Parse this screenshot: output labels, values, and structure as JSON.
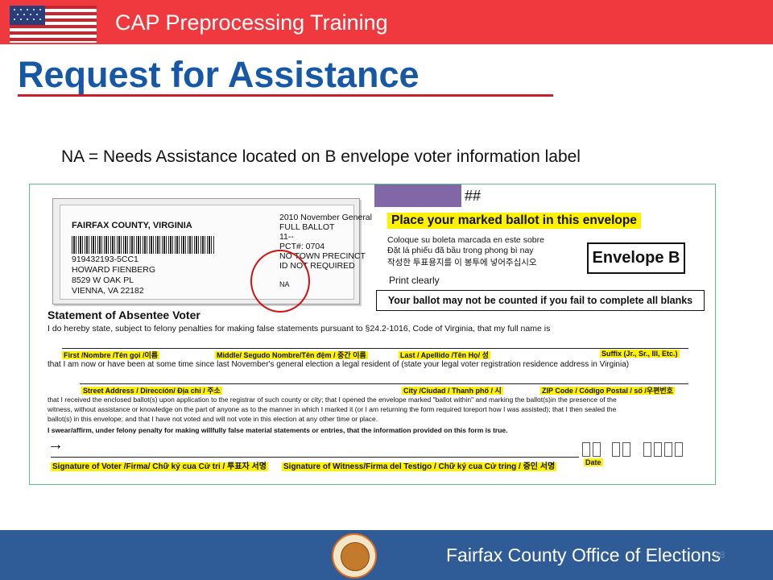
{
  "header": {
    "title": "CAP Preprocessing Training",
    "flag_icon": "us-flag-icon",
    "bar_color": "#f0393f"
  },
  "slide": {
    "title": "Request for Assistance",
    "caption": "NA = Needs Assistance located on B envelope voter information label",
    "title_color": "#1657a6"
  },
  "envelope": {
    "label": {
      "county": "FAIRFAX COUNTY, VIRGINIA",
      "voter_id": "919432193-5CC1",
      "name": "HOWARD FIENBERG",
      "street": "8529 W OAK PL",
      "city": "VIENNA, VA 22182",
      "election": "2010 November General",
      "ballot": "FULL BALLOT",
      "number": "11--",
      "pct": "PCT#: 0704",
      "precinct": "NO TOWN PRECINCT",
      "id_req": "ID NOT REQUIRED",
      "na": "NA"
    },
    "hashes": "##",
    "place_ballot": "Place your marked ballot in this envelope",
    "lang_es": "Coloque su boleta marcada en este sobre",
    "lang_vi": "Đặt lá phiếu đã bầu trong phong bì nay",
    "lang_ko": "작성한 투표용지를 이 봉투에 넣어주십시오",
    "print_clearly": "Print clearly",
    "envelope_b": "Envelope B",
    "warning": "Your ballot may not be counted if you fail to complete all blanks",
    "statement_title": "Statement of Absentee Voter",
    "statement_line1": "I do hereby state, subject to felony penalties for making false statements pursuant to §24.2-1016, Code of Virginia, that my full name is",
    "first_label": "First /Nombre /Tên gọi /이름",
    "middle_label": "Middle/ Segudo Nombre/Tên đệm / 중간 이름",
    "last_label": "Last / Apellido /Tên Họ/ 성",
    "suffix_label": "Suffix (Jr., Sr., III, Etc.)",
    "resident_line": "that I am now or have been at some time since last November's general election a legal resident of (state your legal voter registration residence address in Virginia)",
    "street_label": "Street Address / Dirección/ Địa chỉ / 주소",
    "city_label": "City /Ciudad / Thanh phố / 시",
    "zip_label": "ZIP Code / Código Postal / số /우편번호",
    "received_line1": "that I received the enclosed ballot(s) upon application to the registrar of such county or city; that I opened the envelope marked \"ballot within\" and marking the ballot(s)in the presence of the",
    "received_line2": "witness, without assistance or knowledge on the part of anyone as to the manner in which I marked it (or I am returning the form required toreport how I was assisted); that I then sealed the",
    "received_line3": "ballot(s) in this envelope; and that I have not voted and will not vote in this election at any other time or place.",
    "swear_line": "I swear/affirm, under felony penalty for making willfully false material statements or entries, that the information provided on this form is true.",
    "sig_voter": "Signature of Voter /Firma/ Chữ ký cua Cử tri / 투표자 서명",
    "sig_witness": "Signature of Witness/Firma del Testigo / Chữ ký cua Cử tring / 증인 서명",
    "date_label": "Date",
    "arrow_icon": "right-arrow-icon"
  },
  "footer": {
    "org": "Fairfax County Office of Elections",
    "page": "28",
    "seal_icon": "county-seal-icon",
    "bar_color": "#2f5c96"
  }
}
